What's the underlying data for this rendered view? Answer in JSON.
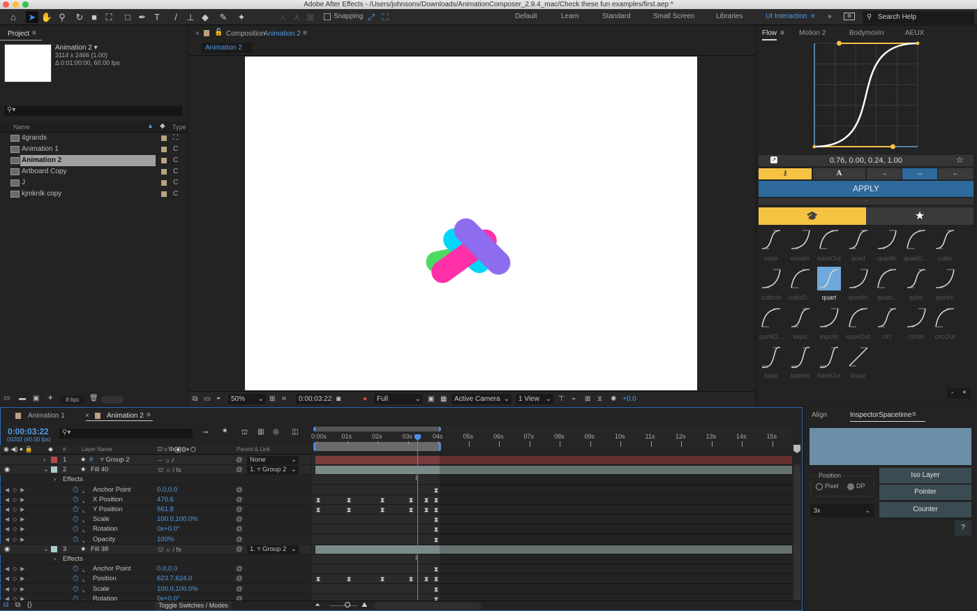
{
  "window": {
    "title": "Adobe After Effects - /Users/johnsonv/Downloads/AnimationComposer_2.9.4_mac/Check these fun examples/first.aep *"
  },
  "toolbar": {
    "snapping_label": "Snapping",
    "workspaces": [
      "Default",
      "Learn",
      "Standard",
      "Small Screen",
      "Libraries",
      "UI Interaction"
    ],
    "active_workspace": "UI Interaction",
    "more": "»",
    "search_placeholder": "Search Help"
  },
  "project": {
    "title": "Project",
    "selected": {
      "name": "Animation 2 ▾",
      "dims": "3114 x 2466 (1.00)",
      "duration": "Δ 0:01:00:00, 60.00 fps"
    },
    "search_placeholder": "",
    "columns": {
      "name": "Name",
      "type": "Type"
    },
    "items": [
      {
        "name": "4grands",
        "type": "⛶"
      },
      {
        "name": "Animation 1",
        "type": "C"
      },
      {
        "name": "Animation 2",
        "type": "C"
      },
      {
        "name": "Artboard Copy",
        "type": "C"
      },
      {
        "name": "J",
        "type": "C"
      },
      {
        "name": "kjmknlk copy",
        "type": "C"
      }
    ],
    "bpc": "8 bpc"
  },
  "composition": {
    "tab_prefix": "Composition",
    "tab_name": "Animation 2",
    "breadcrumb": "Animation 2",
    "footer": {
      "zoom": "50%",
      "timecode": "0:00:03:22",
      "resolution": "Full",
      "camera": "Active Camera",
      "views": "1 View",
      "exposure": "+0.0"
    },
    "shapes": [
      {
        "name": "green-pill",
        "color": "#4cd964"
      },
      {
        "name": "cyan-pill",
        "color": "#00d7f7"
      },
      {
        "name": "pink-pill",
        "color": "#ff2fa8"
      },
      {
        "name": "purple-pill",
        "color": "#8e6cf0"
      }
    ]
  },
  "flow": {
    "tabs": [
      "Flow",
      "Motion 2",
      "Bodymovin",
      "AEUX"
    ],
    "active_tab": "Flow",
    "bezier": [
      0.76,
      0.0,
      0.24,
      1.0
    ],
    "bezier_text": "0.76, 0.00, 0.24, 1.00",
    "apply_label": "APPLY",
    "handle_dots": "...",
    "presets": [
      "ease",
      "easeIn",
      "easeOut",
      "quad",
      "quadIn",
      "quadO...",
      "cubic",
      "cubicIn",
      "cubicO...",
      "quart",
      "quartIn",
      "quart...",
      "quint",
      "quintIn",
      "quintO...",
      "expo",
      "expoIn",
      "expoOut",
      "circ",
      "circIn",
      "circOut",
      "back",
      "backIn",
      "backOut",
      "linear"
    ],
    "selected_preset": "quart",
    "zoom_minus": "-",
    "zoom_plus": "+",
    "colors": {
      "accent": "#f5c242",
      "apply": "#2e6a9e",
      "selected": "#6fa8dc"
    }
  },
  "timeline": {
    "tabs": [
      "Animation 1",
      "Animation 2"
    ],
    "active_tab": "Animation 2",
    "timecode": "0:00:03:22",
    "frame_info": "00202 (60.00 fps)",
    "columns": {
      "layer_name": "Layer Name",
      "parent": "Parent & Link",
      "num": "#"
    },
    "ruler": [
      "0:00s",
      "01s",
      "02s",
      "03s",
      "04s",
      "05s",
      "06s",
      "07s",
      "08s",
      "09s",
      "10s",
      "11s",
      "12s",
      "13s",
      "14s",
      "15s"
    ],
    "layers": [
      {
        "num": "1",
        "name": "▿ Group 2",
        "parent": "None",
        "color": "#b44a4a"
      },
      {
        "num": "2",
        "name": "Fill 40",
        "parent": "1. ▿ Group 2",
        "color": "#a8cdcb"
      },
      {
        "num": "3",
        "name": "Fill 38",
        "parent": "1. ▿ Group 2",
        "color": "#a8cdcb"
      }
    ],
    "effects_label": "Effects",
    "props_fill40": [
      {
        "name": "Anchor Point",
        "value": "0.0,0.0"
      },
      {
        "name": "X Position",
        "value": "470.6"
      },
      {
        "name": "Y Position",
        "value": "561.8"
      },
      {
        "name": "Scale",
        "value": "100.0,100.0%"
      },
      {
        "name": "Rotation",
        "value": "0x+0.0°"
      },
      {
        "name": "Opacity",
        "value": "100%"
      }
    ],
    "props_fill38": [
      {
        "name": "Anchor Point",
        "value": "0.0,0.0"
      },
      {
        "name": "Position",
        "value": "623.7,624.0"
      },
      {
        "name": "Scale",
        "value": "100.0,100.0%"
      },
      {
        "name": "Rotation",
        "value": "0x+0.0°"
      }
    ],
    "toggle_label": "Toggle Switches / Modes"
  },
  "inspector": {
    "tabs": [
      "Align",
      "InspectorSpacetime"
    ],
    "active_tab": "InspectorSpacetime",
    "position_label": "Position",
    "radio_pixel": "Pixel",
    "radio_dp": "DP",
    "scale": "3x",
    "buttons": [
      "Iso Layer",
      "Pointer",
      "Counter"
    ],
    "help": "?",
    "preview_color": "#6a8fa6"
  }
}
